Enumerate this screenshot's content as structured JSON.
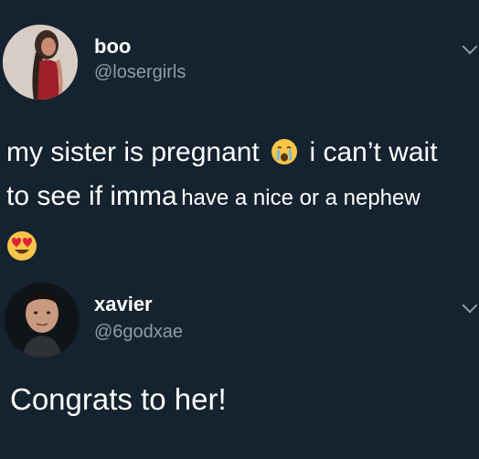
{
  "tweet1": {
    "display_name": "boo",
    "handle": "@losergirls",
    "text_part1": "my sister is pregnant",
    "text_part2": "i can’t wait",
    "text_line2_a": "to see if imma",
    "text_line2_b": "have a nice or a nephew",
    "emoji_after_pregnant": "crying-face-emoji",
    "emoji_line3": "heart-eyes-emoji"
  },
  "tweet2": {
    "display_name": "xavier",
    "handle": "@6godxae",
    "text": "Congrats to her!"
  },
  "colors": {
    "background": "#152230",
    "handle": "#8d9ca9",
    "emoji_yellow": "#f7c64a",
    "heart_red": "#e0203a"
  }
}
